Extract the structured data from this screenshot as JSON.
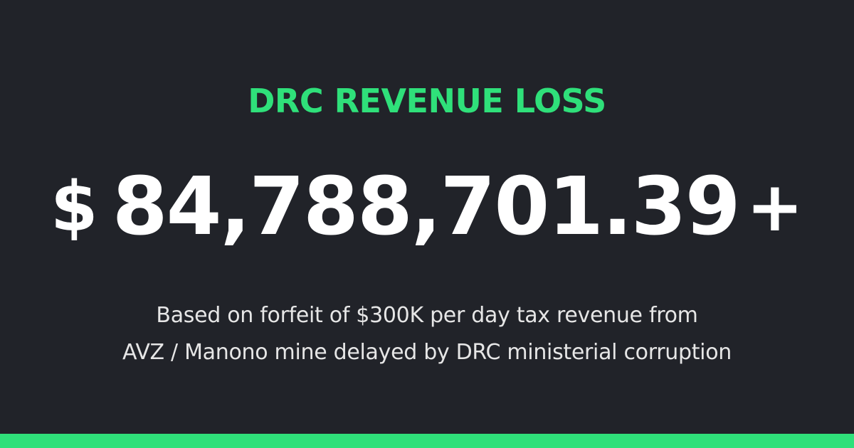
{
  "banner": {
    "title": "DRC REVENUE LOSS",
    "currency_symbol": "$",
    "amount": "84,788,701.39",
    "amount_suffix": "+",
    "description_line1": "Based on forfeit of $300K per day tax revenue from",
    "description_line2": "AVZ / Manono mine delayed by DRC ministerial corruption"
  },
  "colors": {
    "background": "#212329",
    "accent": "#2fe07a",
    "amount_text": "#ffffff",
    "description_text": "#e6e6e6"
  }
}
